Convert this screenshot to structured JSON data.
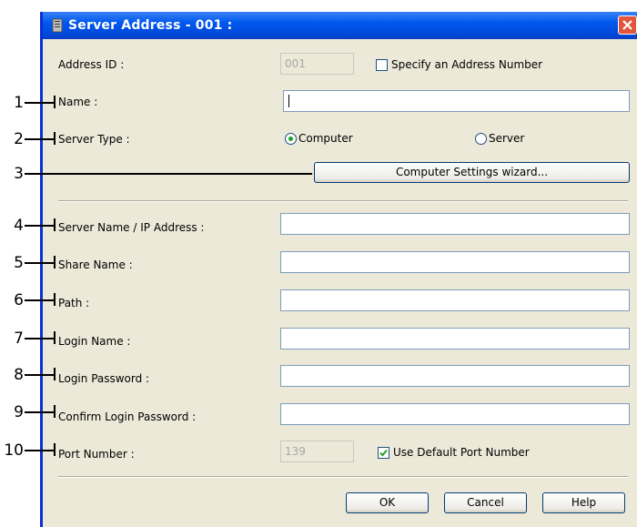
{
  "window": {
    "title": "Server Address - 001 :"
  },
  "labels": {
    "address_id": "Address ID :",
    "name": "Name :",
    "server_type": "Server Type :",
    "server_name": "Server Name / IP Address :",
    "share_name": "Share Name :",
    "path": "Path :",
    "login_name": "Login Name :",
    "login_password": "Login Password :",
    "confirm_password": "Confirm Login Password :",
    "port_number": "Port Number :"
  },
  "fields": {
    "address_id_value": "001",
    "port_number_value": "139"
  },
  "checkboxes": {
    "specify_address": {
      "label": "Specify an Address Number",
      "checked": false
    },
    "default_port": {
      "label": "Use Default Port Number",
      "checked": true
    }
  },
  "radios": {
    "computer": {
      "label": "Computer",
      "selected": true
    },
    "server": {
      "label": "Server",
      "selected": false
    }
  },
  "buttons": {
    "wizard": "Computer Settings wizard...",
    "ok": "OK",
    "cancel": "Cancel",
    "help": "Help"
  },
  "callouts": [
    "1",
    "2",
    "3",
    "4",
    "5",
    "6",
    "7",
    "8",
    "9",
    "10"
  ]
}
